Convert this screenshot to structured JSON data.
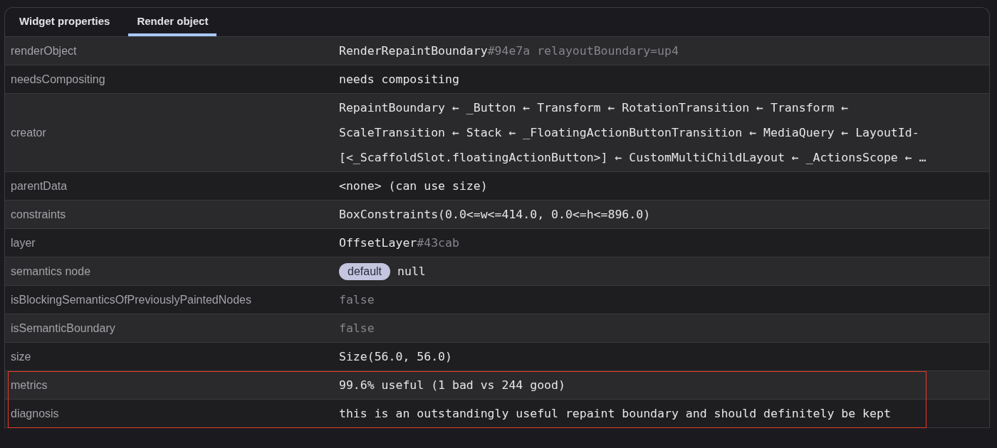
{
  "tabs": [
    {
      "label": "Widget properties",
      "selected": false
    },
    {
      "label": "Render object",
      "selected": true
    }
  ],
  "properties": [
    {
      "name": "renderObject",
      "value": [
        {
          "text": "RenderRepaintBoundary",
          "muted": false
        },
        {
          "text": "#94e7a relayoutBoundary=up4",
          "muted": true
        }
      ],
      "highlight": false
    },
    {
      "name": "needsCompositing",
      "value": [
        {
          "text": "needs compositing",
          "muted": false
        }
      ],
      "highlight": false
    },
    {
      "name": "creator",
      "value": [
        {
          "text": "RepaintBoundary ← _Button ← Transform ← RotationTransition ← Transform ← ScaleTransition ← Stack ← _FloatingActionButtonTransition ← MediaQuery ← LayoutId-[<_ScaffoldSlot.floatingActionButton>] ← CustomMultiChildLayout ← _ActionsScope ← …",
          "muted": false
        }
      ],
      "highlight": false
    },
    {
      "name": "parentData",
      "value": [
        {
          "text": "<none> (can use size)",
          "muted": false
        }
      ],
      "highlight": false
    },
    {
      "name": "constraints",
      "value": [
        {
          "text": "BoxConstraints(0.0<=w<=414.0, 0.0<=h<=896.0)",
          "muted": false
        }
      ],
      "highlight": false
    },
    {
      "name": "layer",
      "value": [
        {
          "text": "OffsetLayer",
          "muted": false
        },
        {
          "text": "#43cab",
          "muted": true
        }
      ],
      "highlight": false
    },
    {
      "name": "semantics node",
      "badge": "default",
      "value": [
        {
          "text": "null",
          "muted": false
        }
      ],
      "highlight": false
    },
    {
      "name": "isBlockingSemanticsOfPreviouslyPaintedNodes",
      "value": [
        {
          "text": "false",
          "muted": true
        }
      ],
      "highlight": false
    },
    {
      "name": "isSemanticBoundary",
      "value": [
        {
          "text": "false",
          "muted": true
        }
      ],
      "highlight": false
    },
    {
      "name": "size",
      "value": [
        {
          "text": "Size(56.0, 56.0)",
          "muted": false
        }
      ],
      "highlight": false
    },
    {
      "name": "metrics",
      "value": [
        {
          "text": "99.6% useful (1 bad vs 244 good)",
          "muted": false
        }
      ],
      "highlight": true
    },
    {
      "name": "diagnosis",
      "value": [
        {
          "text": "this is an outstandingly useful repaint boundary and should definitely be kept",
          "muted": false
        }
      ],
      "highlight": true
    }
  ]
}
